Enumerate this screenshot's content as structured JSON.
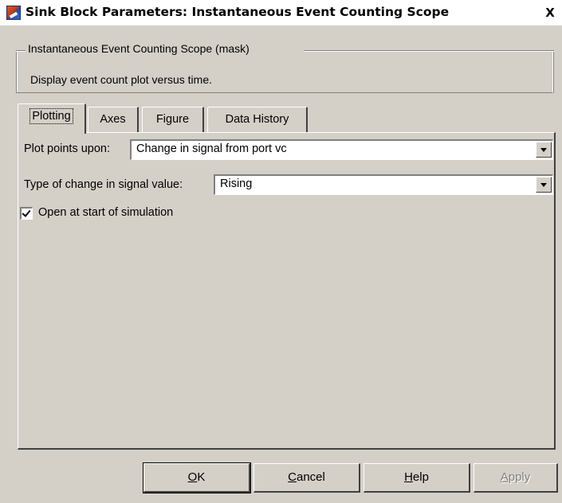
{
  "window": {
    "title": "Sink Block Parameters: Instantaneous Event Counting Scope",
    "close_glyph": "X"
  },
  "group": {
    "legend": "Instantaneous Event Counting Scope (mask)",
    "description": "Display event count plot versus time."
  },
  "tabs": [
    {
      "label": "Plotting",
      "active": true
    },
    {
      "label": "Axes",
      "active": false
    },
    {
      "label": "Figure",
      "active": false
    },
    {
      "label": "Data History",
      "active": false
    }
  ],
  "plotting": {
    "plot_points_label": "Plot points upon:",
    "plot_points_value": "Change in signal from port vc",
    "change_type_label": "Type of change in signal value:",
    "change_type_value": "Rising",
    "open_at_start_label": "Open at start of simulation",
    "open_at_start_checked": true
  },
  "buttons": {
    "ok": {
      "mnemonic": "O",
      "rest": "K"
    },
    "cancel": {
      "mnemonic": "C",
      "rest": "ancel"
    },
    "help": {
      "mnemonic": "H",
      "rest": "elp"
    },
    "apply": {
      "mnemonic": "A",
      "rest": "pply",
      "disabled": true
    }
  },
  "icons": {
    "app": "simulink-block-icon",
    "close": "close-icon",
    "dropdown": "chevron-down-icon",
    "check": "checkmark-icon"
  }
}
